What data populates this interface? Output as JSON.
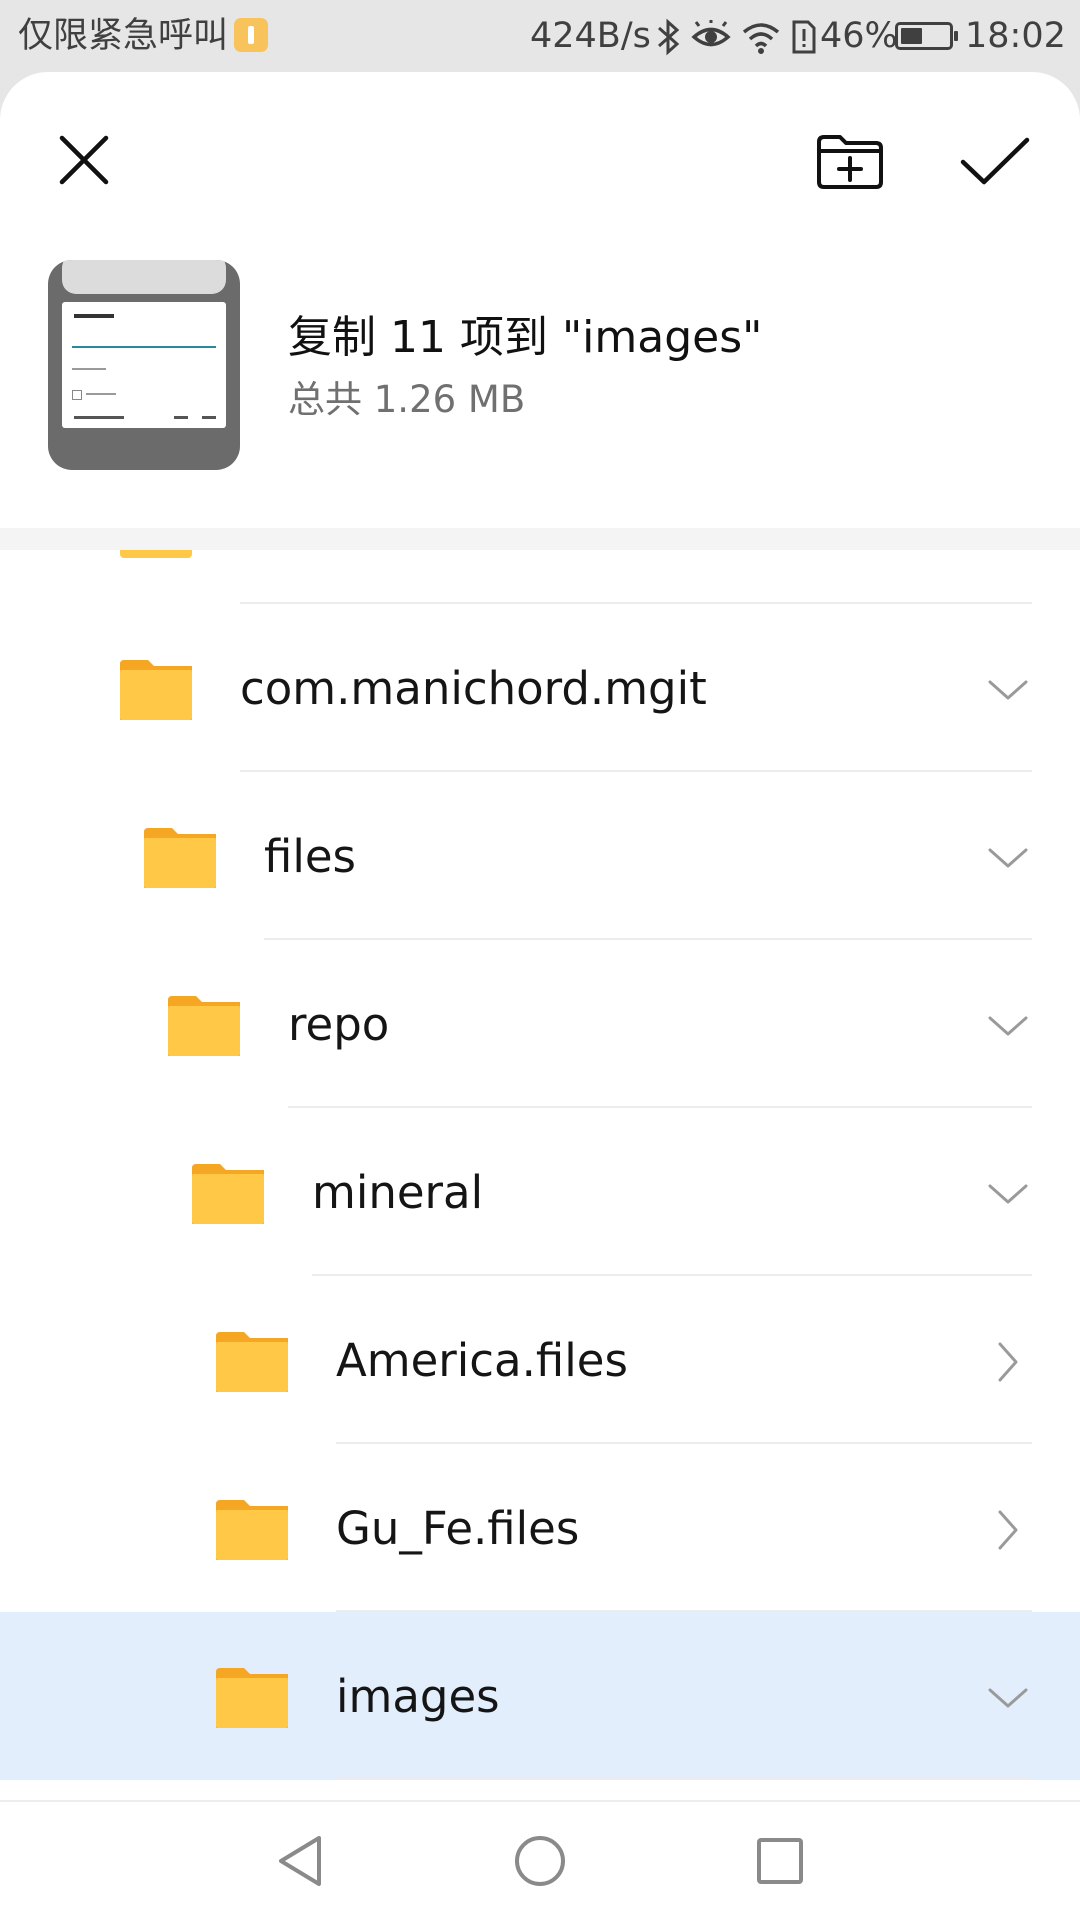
{
  "status_bar": {
    "carrier": "仅限紧急呼叫",
    "net_speed": "424B/s",
    "battery_percent": "46%",
    "battery_level": 0.46,
    "time": "18:02"
  },
  "toolbar": {
    "close_icon": "close-icon",
    "new_folder_icon": "new-folder-icon",
    "confirm_icon": "checkmark-icon"
  },
  "copy_info": {
    "title": "复制 11 项到 \"images\"",
    "subtitle": "总共 1.26 MB"
  },
  "folders": [
    {
      "name": "com.manichord.mgit",
      "depth": 0,
      "state": "expanded",
      "selected": false
    },
    {
      "name": "files",
      "depth": 1,
      "state": "expanded",
      "selected": false
    },
    {
      "name": "repo",
      "depth": 2,
      "state": "expanded",
      "selected": false
    },
    {
      "name": "mineral",
      "depth": 3,
      "state": "expanded",
      "selected": false
    },
    {
      "name": "America.files",
      "depth": 4,
      "state": "collapsed",
      "selected": false
    },
    {
      "name": "Gu_Fe.files",
      "depth": 4,
      "state": "collapsed",
      "selected": false
    },
    {
      "name": "images",
      "depth": 4,
      "state": "expanded",
      "selected": true
    }
  ],
  "colors": {
    "folder": "#ffc847",
    "folder_tab": "#f5a623",
    "selected_row": "#e3eefc"
  },
  "nav_bar": {
    "back_icon": "back-triangle-icon",
    "home_icon": "home-circle-icon",
    "recents_icon": "recents-square-icon"
  }
}
